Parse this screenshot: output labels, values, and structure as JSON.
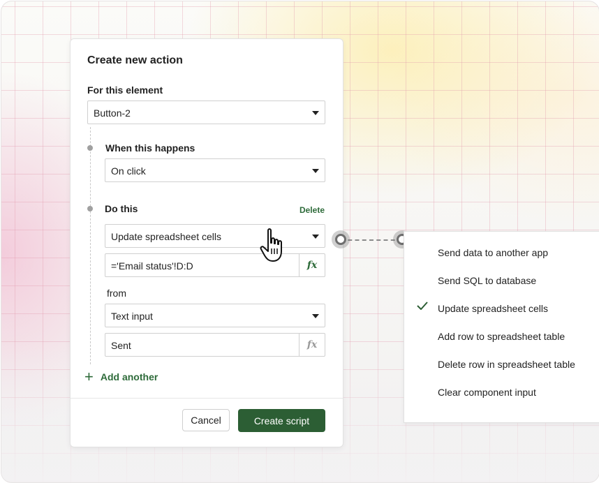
{
  "panel": {
    "title": "Create new action",
    "element_label": "For this element",
    "element_value": "Button-2",
    "when_label": "When this happens",
    "when_value": "On click",
    "do_label": "Do this",
    "delete_label": "Delete",
    "do_value": "Update spreadsheet cells",
    "formula_value": "='Email status'!D:D",
    "formula_icon": "fx",
    "from_label": "from",
    "from_value": "Text input",
    "sent_value": "Sent",
    "sent_icon": "fx",
    "add_another": "Add another",
    "cancel_label": "Cancel",
    "create_label": "Create script"
  },
  "menu": {
    "items": [
      {
        "label": "Send data to another app",
        "selected": false
      },
      {
        "label": "Send SQL to database",
        "selected": false
      },
      {
        "label": "Update spreadsheet cells",
        "selected": true
      },
      {
        "label": "Add row to spreadsheet table",
        "selected": false
      },
      {
        "label": "Delete row in spreadsheet table",
        "selected": false
      },
      {
        "label": "Clear component input",
        "selected": false
      }
    ]
  },
  "colors": {
    "accent": "#2c5e34",
    "accent_text": "#2e6b3a"
  }
}
